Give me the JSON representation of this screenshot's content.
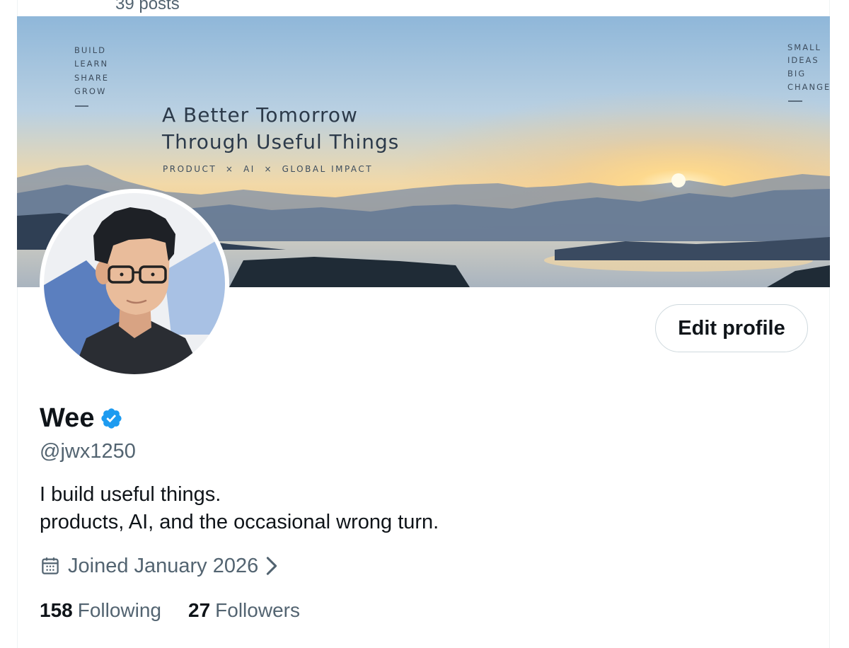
{
  "header": {
    "posts_count": "39 posts"
  },
  "banner": {
    "left_words": [
      "BUILD",
      "LEARN",
      "SHARE",
      "GROW"
    ],
    "right_words": [
      "SMALL",
      "IDEAS",
      "BIG",
      "CHANGE"
    ],
    "headline_line1": "A Better Tomorrow",
    "headline_line2": "Through Useful Things",
    "tagline": "PRODUCT  ×  AI  ×  GLOBAL IMPACT"
  },
  "profile": {
    "edit_button_label": "Edit profile",
    "display_name": "Wee",
    "handle": "@jwx1250",
    "bio_line1": "I build useful things.",
    "bio_line2": "products, AI, and the occasional wrong turn.",
    "joined": "Joined January 2026",
    "following_count": "158",
    "following_label": "Following",
    "followers_count": "27",
    "followers_label": "Followers"
  },
  "icons": {
    "verified": "verified-badge-icon",
    "calendar": "calendar-icon",
    "chevron": "chevron-right-icon"
  },
  "colors": {
    "text_primary": "#0f1419",
    "text_secondary": "#536471",
    "verified_blue": "#1d9bf0",
    "button_border": "#cfd9de"
  }
}
